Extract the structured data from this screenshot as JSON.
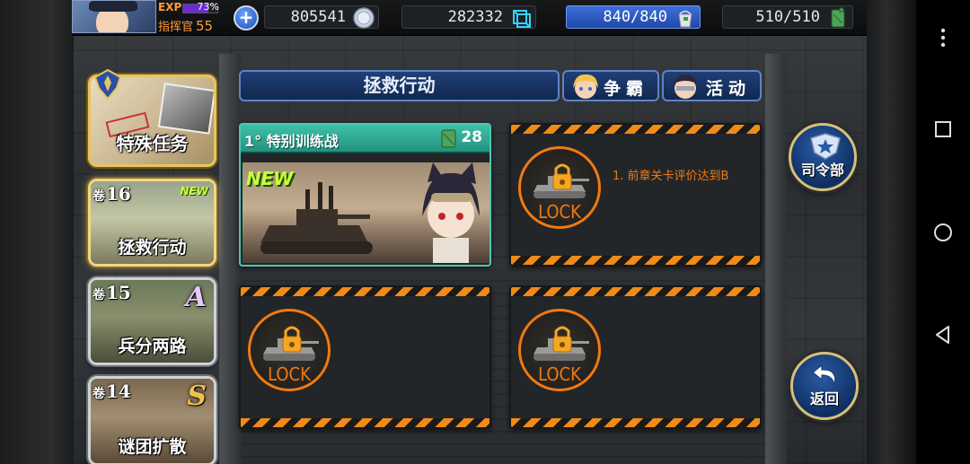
{
  "player": {
    "exp_label": "EXP",
    "exp_percent_text": "73%",
    "exp_fraction": 0.73,
    "rank_label": "指挥官",
    "level": "55"
  },
  "resources": {
    "coins": "805541",
    "crystals": "282332",
    "energy": "840/840",
    "energy_fraction": 1.0,
    "fuel": "510/510"
  },
  "chapters": {
    "special": {
      "title": "特殊任务"
    },
    "items": [
      {
        "vol": "卷",
        "num": "16",
        "title": "拯救行动",
        "tag": "NEW",
        "grade": "",
        "active": true
      },
      {
        "vol": "卷",
        "num": "15",
        "title": "兵分两路",
        "tag": "",
        "grade": "A",
        "grade_color": "#e6c7ff"
      },
      {
        "vol": "卷",
        "num": "14",
        "title": "谜团扩散",
        "tag": "",
        "grade": "S",
        "grade_color": "#f5c04a"
      }
    ]
  },
  "header": {
    "stage_title": "拯救行动",
    "tabs": [
      {
        "label": "争霸"
      },
      {
        "label": "活动"
      }
    ]
  },
  "missions": [
    {
      "state": "open",
      "name": "1° 特别训练战",
      "cost": "28",
      "tag": "NEW"
    },
    {
      "state": "locked",
      "lock_text": "LOCK",
      "requirement": "1. 前章关卡评价达到B"
    },
    {
      "state": "locked",
      "lock_text": "LOCK"
    },
    {
      "state": "locked",
      "lock_text": "LOCK"
    }
  ],
  "right_buttons": {
    "hq_label": "司令部",
    "back_label": "返回"
  },
  "colors": {
    "accent_orange": "#f07a12",
    "teal": "#3fc2a8",
    "navy": "#1f3f78"
  }
}
